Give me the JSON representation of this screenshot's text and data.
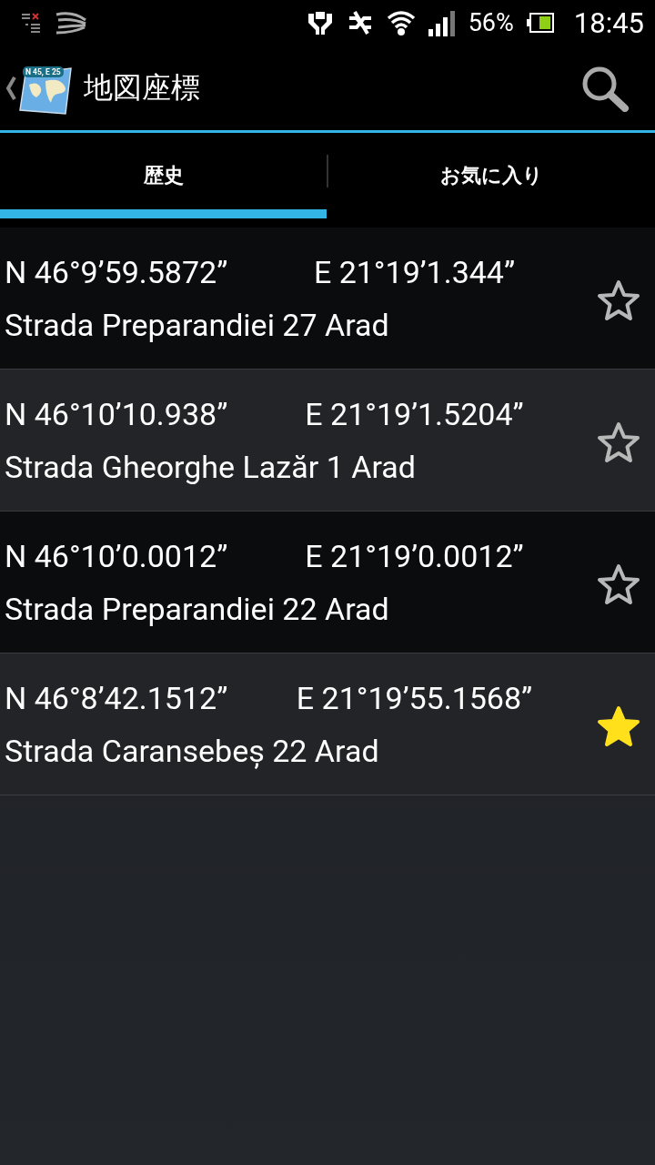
{
  "status_bar": {
    "battery": "56%",
    "time": "18:45"
  },
  "app_bar": {
    "logo_text": "N 45, E 25",
    "title": "地図座標"
  },
  "tabs": [
    {
      "label": "歴史",
      "selected": true
    },
    {
      "label": "お気に入り",
      "selected": false
    }
  ],
  "locations": [
    {
      "latitude": "N 46°9’59.5872”",
      "longitude": "E 21°19’1.344”",
      "address": "Strada Preparandiei 27 Arad",
      "favorite": false
    },
    {
      "latitude": "N 46°10’10.938”",
      "longitude": "E 21°19’1.5204”",
      "address": "Strada Gheorghe Lazăr 1 Arad",
      "favorite": false
    },
    {
      "latitude": "N 46°10’0.0012”",
      "longitude": "E 21°19’0.0012”",
      "address": "Strada Preparandiei 22 Arad",
      "favorite": false
    },
    {
      "latitude": "N 46°8’42.1512”",
      "longitude": "E 21°19’55.1568”",
      "address": "Strada Caransebeș 22 Arad",
      "favorite": true
    }
  ]
}
